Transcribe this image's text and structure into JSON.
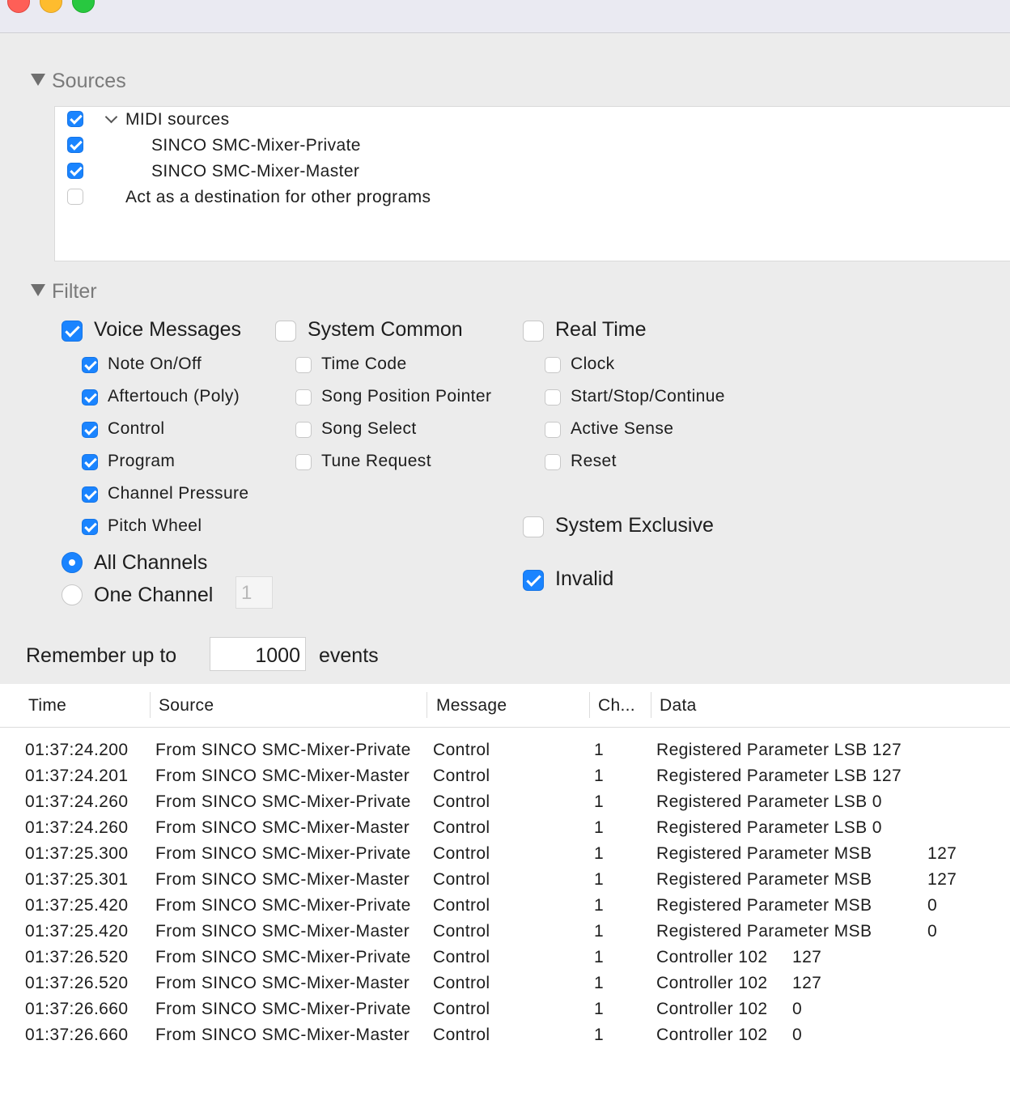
{
  "window": {
    "controls": [
      "close",
      "minimize",
      "zoom"
    ]
  },
  "sources": {
    "heading": "Sources",
    "items": [
      {
        "label": "MIDI sources",
        "checked": true,
        "indent": 1,
        "expandable": true
      },
      {
        "label": "SINCO SMC-Mixer-Private",
        "checked": true,
        "indent": 2
      },
      {
        "label": "SINCO SMC-Mixer-Master",
        "checked": true,
        "indent": 2
      },
      {
        "label": "Act as a destination for other programs",
        "checked": false,
        "indent": 1
      }
    ]
  },
  "filter": {
    "heading": "Filter",
    "voice": {
      "label": "Voice Messages",
      "checked": true,
      "items": [
        {
          "label": "Note On/Off",
          "checked": true
        },
        {
          "label": "Aftertouch (Poly)",
          "checked": true
        },
        {
          "label": "Control",
          "checked": true
        },
        {
          "label": "Program",
          "checked": true
        },
        {
          "label": "Channel Pressure",
          "checked": true
        },
        {
          "label": "Pitch Wheel",
          "checked": true
        }
      ]
    },
    "system_common": {
      "label": "System Common",
      "checked": false,
      "items": [
        {
          "label": "Time Code",
          "checked": false
        },
        {
          "label": "Song Position Pointer",
          "checked": false
        },
        {
          "label": "Song Select",
          "checked": false
        },
        {
          "label": "Tune Request",
          "checked": false
        }
      ]
    },
    "real_time": {
      "label": "Real Time",
      "checked": false,
      "items": [
        {
          "label": "Clock",
          "checked": false
        },
        {
          "label": "Start/Stop/Continue",
          "checked": false
        },
        {
          "label": "Active Sense",
          "checked": false
        },
        {
          "label": "Reset",
          "checked": false
        }
      ]
    },
    "system_exclusive": {
      "label": "System Exclusive",
      "checked": false
    },
    "invalid": {
      "label": "Invalid",
      "checked": true
    },
    "channels": {
      "all_label": "All Channels",
      "one_label": "One Channel",
      "selected": "all",
      "one_channel_value": "1"
    }
  },
  "remember": {
    "label": "Remember up to",
    "value": "1000",
    "suffix": "events"
  },
  "table": {
    "columns": [
      "Time",
      "Source",
      "Message",
      "Ch...",
      "Data"
    ],
    "rows": [
      [
        "01:37:24.200",
        "From SINCO SMC-Mixer-Private",
        "Control",
        "1",
        "Registered Parameter LSB 127",
        ""
      ],
      [
        "01:37:24.201",
        "From SINCO SMC-Mixer-Master",
        "Control",
        "1",
        "Registered Parameter LSB 127",
        ""
      ],
      [
        "01:37:24.260",
        "From SINCO SMC-Mixer-Private",
        "Control",
        "1",
        "Registered Parameter LSB 0",
        ""
      ],
      [
        "01:37:24.260",
        "From SINCO SMC-Mixer-Master",
        "Control",
        "1",
        "Registered Parameter LSB 0",
        ""
      ],
      [
        "01:37:25.300",
        "From SINCO SMC-Mixer-Private",
        "Control",
        "1",
        "Registered Parameter MSB",
        "127"
      ],
      [
        "01:37:25.301",
        "From SINCO SMC-Mixer-Master",
        "Control",
        "1",
        "Registered Parameter MSB",
        "127"
      ],
      [
        "01:37:25.420",
        "From SINCO SMC-Mixer-Private",
        "Control",
        "1",
        "Registered Parameter MSB",
        "0"
      ],
      [
        "01:37:25.420",
        "From SINCO SMC-Mixer-Master",
        "Control",
        "1",
        "Registered Parameter MSB",
        "0"
      ],
      [
        "01:37:26.520",
        "From SINCO SMC-Mixer-Private",
        "Control",
        "1",
        "Controller 102",
        "127"
      ],
      [
        "01:37:26.520",
        "From SINCO SMC-Mixer-Master",
        "Control",
        "1",
        "Controller 102",
        "127"
      ],
      [
        "01:37:26.660",
        "From SINCO SMC-Mixer-Private",
        "Control",
        "1",
        "Controller 102",
        "0"
      ],
      [
        "01:37:26.660",
        "From SINCO SMC-Mixer-Master",
        "Control",
        "1",
        "Controller 102",
        "0"
      ]
    ]
  }
}
